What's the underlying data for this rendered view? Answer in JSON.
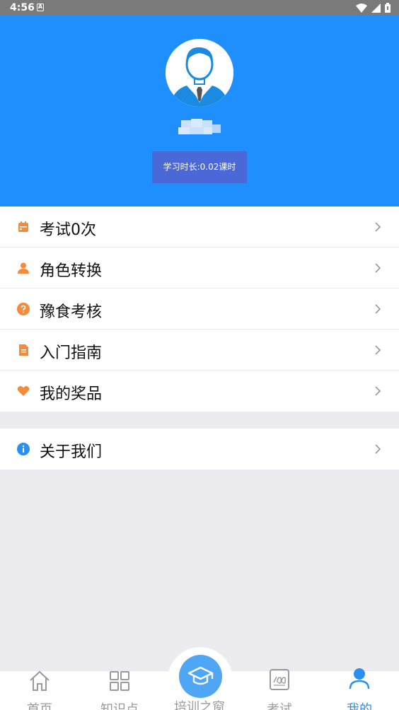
{
  "status_bar": {
    "time": "4:56",
    "notification_glyph": "A"
  },
  "profile": {
    "study_time": "学习时长:0.02课时"
  },
  "menu": {
    "items": [
      {
        "label": "考试0次",
        "icon": "calendar-icon",
        "color": "#f58a3a"
      },
      {
        "label": "角色转换",
        "icon": "person-icon",
        "color": "#f58a3a"
      },
      {
        "label": "豫食考核",
        "icon": "question-icon",
        "color": "#f58a3a"
      },
      {
        "label": "入门指南",
        "icon": "document-icon",
        "color": "#f58a3a"
      },
      {
        "label": "我的奖品",
        "icon": "heart-icon",
        "color": "#f58a3a"
      }
    ],
    "about": {
      "label": "关于我们",
      "icon": "info-icon",
      "color": "#2a8ff0"
    }
  },
  "tabbar": {
    "tabs": [
      {
        "label": "首页",
        "icon": "home-icon"
      },
      {
        "label": "知识点",
        "icon": "grid-icon"
      },
      {
        "label": "培训之窗",
        "icon": "graduation-cap-icon"
      },
      {
        "label": "考试",
        "icon": "exam-paper-icon"
      },
      {
        "label": "我的",
        "icon": "profile-icon",
        "active": true
      }
    ]
  },
  "colors": {
    "header_blue": "#1e8ffd",
    "study_button": "#4a68d8",
    "accent_orange": "#f58a3a",
    "active_tab": "#2a8ff0"
  }
}
